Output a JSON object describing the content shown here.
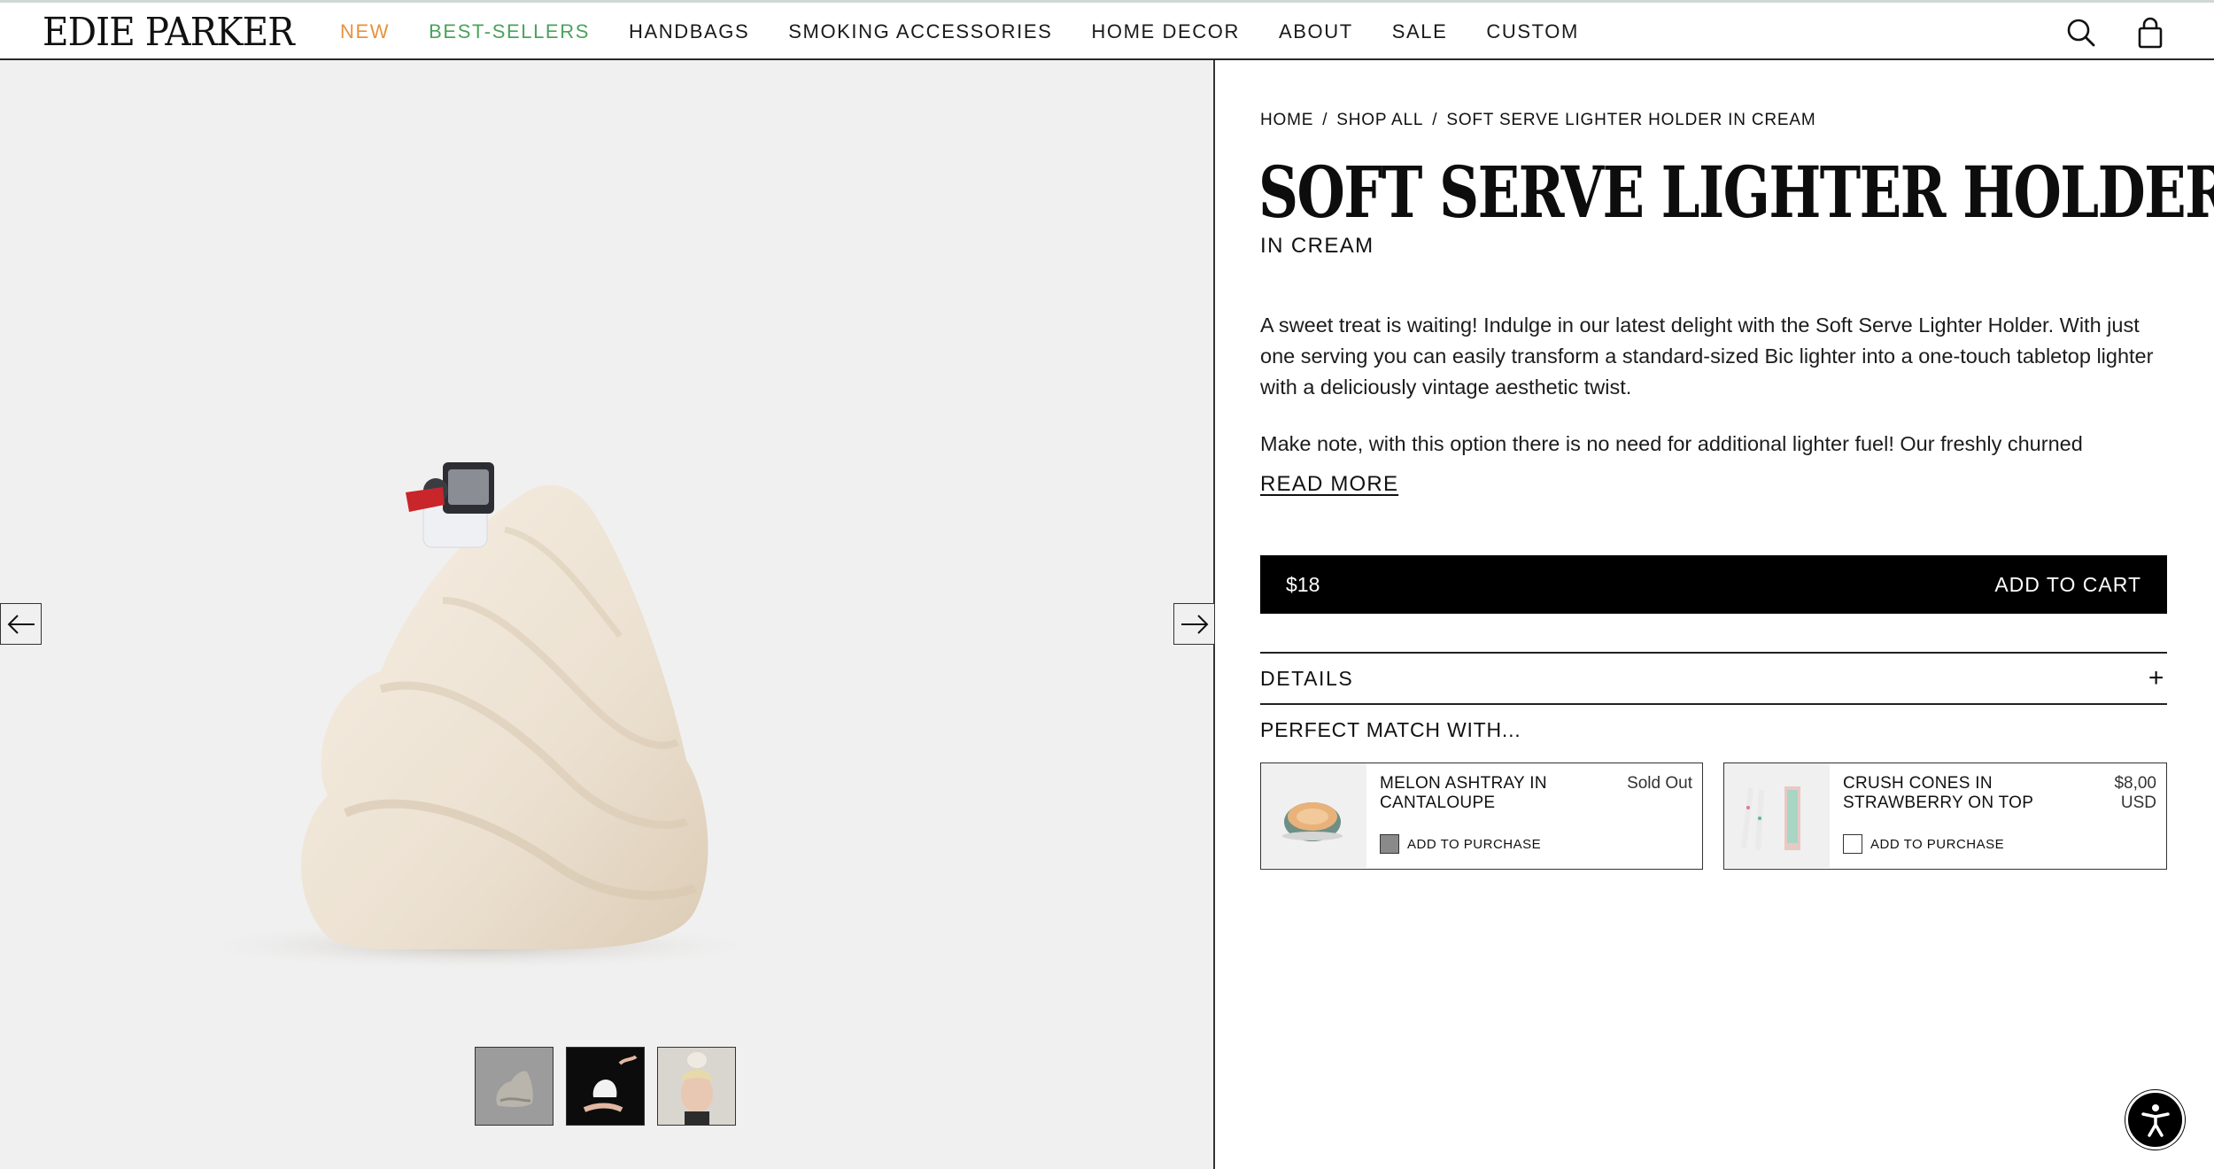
{
  "brand": {
    "logo": "EDIE PARKER"
  },
  "nav": {
    "items": [
      {
        "label": "NEW"
      },
      {
        "label": "BEST-SELLERS"
      },
      {
        "label": "HANDBAGS"
      },
      {
        "label": "SMOKING ACCESSORIES"
      },
      {
        "label": "HOME DECOR"
      },
      {
        "label": "ABOUT"
      },
      {
        "label": "SALE"
      },
      {
        "label": "CUSTOM"
      }
    ],
    "accent_new": "#e8923e",
    "accent_best": "#4aa35b"
  },
  "header_icons": [
    "search-icon",
    "shopping-bag-icon"
  ],
  "gallery": {
    "arrows": [
      "arrow-left-icon",
      "arrow-right-icon"
    ],
    "thumbnail_count": 3
  },
  "breadcrumb": {
    "home": "HOME",
    "shop_all": "SHOP ALL",
    "current": "SOFT SERVE LIGHTER HOLDER IN CREAM",
    "sep": "/"
  },
  "product": {
    "title": "SOFT SERVE LIGHTER HOLDER",
    "subtitle": "IN CREAM",
    "description_1": "A sweet treat is waiting! Indulge in our latest delight with the Soft Serve Lighter Holder. With just one serving you can easily transform a standard-sized Bic lighter into a one-touch tabletop lighter with a deliciously vintage aesthetic twist.",
    "description_2": "Make note, with this option there is no need for additional lighter fuel! Our freshly churned",
    "read_more": "READ MORE",
    "price": "$18",
    "add_to_cart": "ADD TO CART",
    "details_label": "DETAILS",
    "details_toggle": "+"
  },
  "perfect_match": {
    "title": "PERFECT MATCH WITH...",
    "items": [
      {
        "name": "MELON ASHTRAY IN CANTALOUPE",
        "price": "Sold Out",
        "action": "ADD TO PURCHASE"
      },
      {
        "name": "CRUSH CONES IN STRAWBERRY ON TOP",
        "price": "$8,00 USD",
        "action": "ADD TO PURCHASE"
      }
    ]
  },
  "accessibility": {
    "icon": "accessibility-icon"
  }
}
